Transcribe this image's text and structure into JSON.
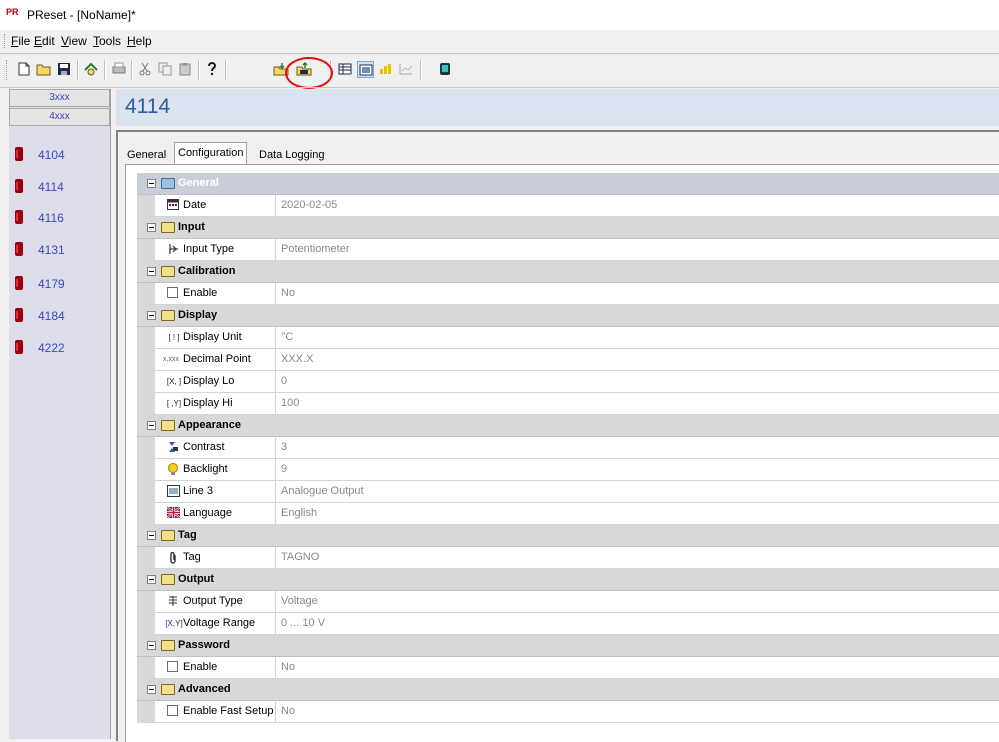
{
  "window": {
    "title": "PReset - [NoName]*",
    "logo_text": "PR"
  },
  "menu": [
    {
      "label": "File"
    },
    {
      "label": "Edit"
    },
    {
      "label": "View"
    },
    {
      "label": "Tools"
    },
    {
      "label": "Help"
    }
  ],
  "toolbar": {
    "buttons": [
      "new-icon",
      "open-icon",
      "save-icon",
      "wizard-icon",
      "print-icon",
      "cut-icon",
      "copy-icon",
      "paste-icon",
      "help-icon",
      "read-from-device-icon",
      "write-to-device-icon",
      "table-view-icon",
      "form-view-icon",
      "chart-icon",
      "graph-icon",
      "device-icon"
    ],
    "highlight_color": "#e01010"
  },
  "sidebar": {
    "groups": [
      {
        "label": "3xxx"
      },
      {
        "label": "4xxx"
      }
    ],
    "devices": [
      {
        "label": "4104"
      },
      {
        "label": "4114"
      },
      {
        "label": "4116"
      },
      {
        "label": "4131"
      },
      {
        "label": "4179"
      },
      {
        "label": "4184"
      },
      {
        "label": "4222"
      }
    ]
  },
  "main": {
    "title": "4114",
    "tabs": [
      {
        "label": "General"
      },
      {
        "label": "Configuration"
      },
      {
        "label": "Data Logging"
      }
    ],
    "active_tab": "Configuration"
  },
  "grid": {
    "general": {
      "label": "General",
      "date_label": "Date",
      "date_value": "2020-02-05"
    },
    "input": {
      "label": "Input",
      "type_label": "Input Type",
      "type_value": "Potentiometer"
    },
    "calibration": {
      "label": "Calibration",
      "enable_label": "Enable",
      "enable_value": "No"
    },
    "display": {
      "label": "Display",
      "unit_label": "Display Unit",
      "unit_value": "°C",
      "unit_icon_text": "[ ! ]",
      "decimal_label": "Decimal Point",
      "decimal_value": "XXX.X",
      "decimal_icon_text": "x,xxx",
      "lo_label": "Display Lo",
      "lo_value": "0",
      "lo_icon_text": "[X, ]",
      "hi_label": "Display Hi",
      "hi_value": "100",
      "hi_icon_text": "[ ,Y]"
    },
    "appearance": {
      "label": "Appearance",
      "contrast_label": "Contrast",
      "contrast_value": "3",
      "backlight_label": "Backlight",
      "backlight_value": "9",
      "line3_label": "Line 3",
      "line3_value": "Analogue Output",
      "language_label": "Language",
      "language_value": "English"
    },
    "tag": {
      "label": "Tag",
      "tag_label": "Tag",
      "tag_value": "TAGNO"
    },
    "output": {
      "label": "Output",
      "type_label": "Output Type",
      "type_value": "Voltage",
      "range_label": "Voltage Range",
      "range_value": "0 ... 10 V",
      "range_icon_text": "[X,Y]"
    },
    "password": {
      "label": "Password",
      "enable_label": "Enable",
      "enable_value": "No"
    },
    "advanced": {
      "label": "Advanced",
      "fast_label": "Enable Fast Setup",
      "fast_value": "No"
    }
  }
}
